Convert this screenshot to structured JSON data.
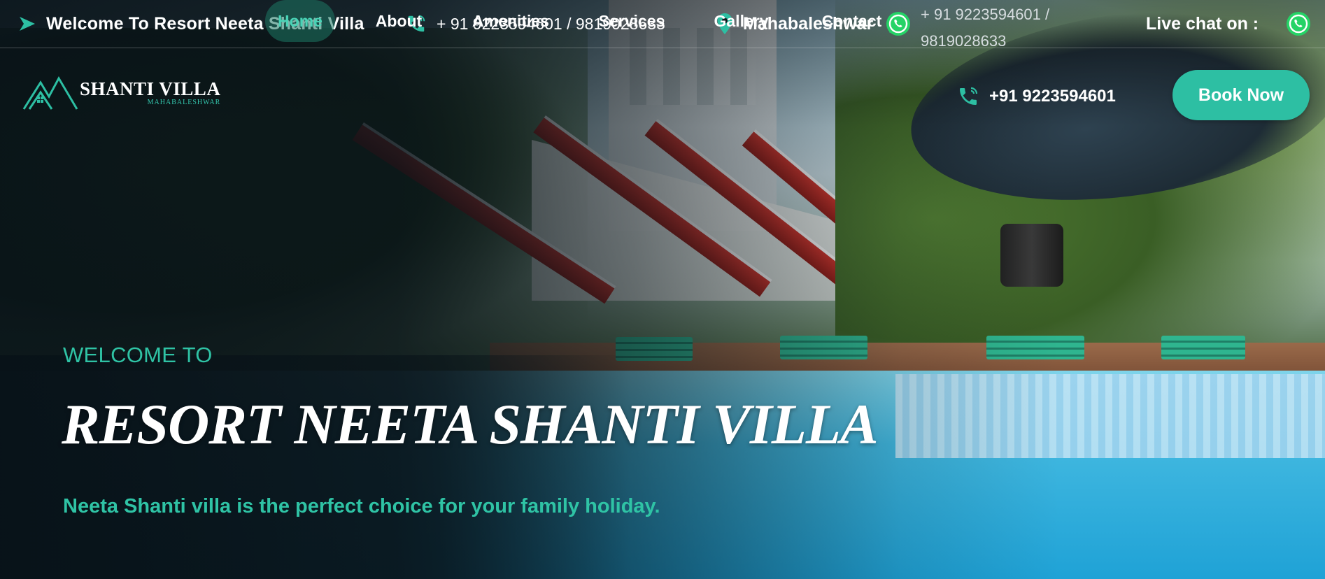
{
  "topbar": {
    "welcome": "Welcome To Resort Neeta Shanti Villa",
    "phone": "+ 91 9223594601 / 9819028633",
    "location": "Mahabaleshwar",
    "whatsapp_number": "+ 91 9223594601 / 9819028633",
    "live_chat": "Live chat on :"
  },
  "logo": {
    "title": "SHANTI VILLA",
    "subtitle": "MAHABALESHWAR"
  },
  "nav": {
    "items": [
      {
        "label": "Home"
      },
      {
        "label": "About"
      },
      {
        "label": "Amenities"
      },
      {
        "label": "Services"
      },
      {
        "label": "Gallery"
      },
      {
        "label": "Contact"
      }
    ],
    "phone": "+91 9223594601",
    "book_button": "Book Now"
  },
  "hero": {
    "kicker": "WELCOME TO",
    "title": "RESORT NEETA SHANTI VILLA",
    "subtitle": "Neeta Shanti villa is the perfect choice for your family holiday."
  },
  "colors": {
    "accent": "#2dbfa3",
    "accent_text": "#2fc3a5",
    "whatsapp": "#25d366"
  },
  "icons": [
    "arrow-icon",
    "phone-icon",
    "location-pin-icon",
    "whatsapp-icon"
  ]
}
